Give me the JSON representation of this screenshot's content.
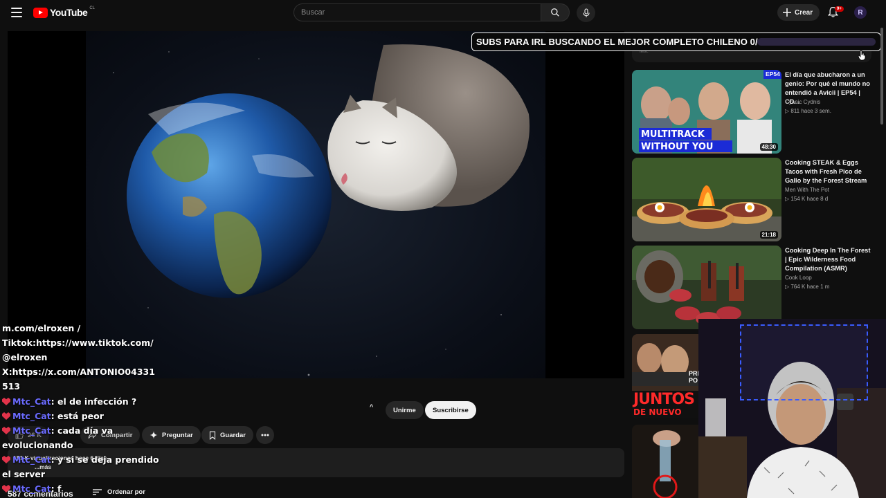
{
  "header": {
    "logo_text": "YouTube",
    "logo_country": "CL",
    "search_placeholder": "Buscar",
    "create_label": "Crear",
    "notifications_badge": "9+",
    "avatar_letter": "R"
  },
  "overlay": {
    "goal_text": "SUBS PARA IRL BUSCANDO EL MEJOR COMPLETO CHILENO 0/9",
    "goal_progress": 0,
    "mix_label": "Mix:",
    "stream_links": [
      "m.com/elroxen /",
      "Tiktok:https://www.tiktok.com/",
      "@elroxen",
      "X:https://x.com/ANTONIO04331",
      "513"
    ],
    "chat": [
      {
        "user": "Mtc_Cat",
        "message": "el de infección ?"
      },
      {
        "user": "Mtc_Cat",
        "message": "está peor"
      },
      {
        "user": "Mtc_Cat",
        "message": "cada día va"
      },
      {
        "user": "",
        "message": "evolucionando"
      },
      {
        "user": "Mtc_Cat",
        "message": "y si se deja prendido"
      },
      {
        "user": "",
        "message": "el server"
      },
      {
        "user": "Mtc_Cat",
        "message": "f"
      }
    ]
  },
  "video_actions": {
    "likes": "26 K",
    "share": "Compartir",
    "ask": "Preguntar",
    "save": "Guardar",
    "join": "Unirme",
    "subscribe": "Suscribirse",
    "caret": "^"
  },
  "description": {
    "views": "151 K visualizaciones  hace 6 días",
    "more": "...más"
  },
  "comments": {
    "count": "587 comentarios",
    "sort": "Ordenar por"
  },
  "recommendations": [
    {
      "title": "El día que abucharon a un genio: Por qué el mundo no entendió a Avicii | EP54 | CD...",
      "channel": "Cyanic Cydnis",
      "meta": "▷ 811  hace 3 sem.",
      "duration": "48:30",
      "thumb_text_1": "MULTITRACK",
      "thumb_text_2": "WITHOUT YOU",
      "badge": "EP54"
    },
    {
      "title": "Cooking STEAK & Eggs Tacos with Fresh Pico de Gallo by the Forest Stream",
      "channel": "Men With The Pot",
      "meta": "▷ 154 K  hace 8 d",
      "duration": "21:18"
    },
    {
      "title": "Cooking Deep In The Forest | Epic Wilderness Food Compilation (ASMR)",
      "channel": "Cook Loop",
      "meta": "▷ 764 K  hace 1 m",
      "duration": ""
    }
  ],
  "partial_thumb": {
    "line1": "PRE",
    "line2": "PO",
    "banner1": "JUNTOS",
    "banner2": "DE NUEVO"
  }
}
